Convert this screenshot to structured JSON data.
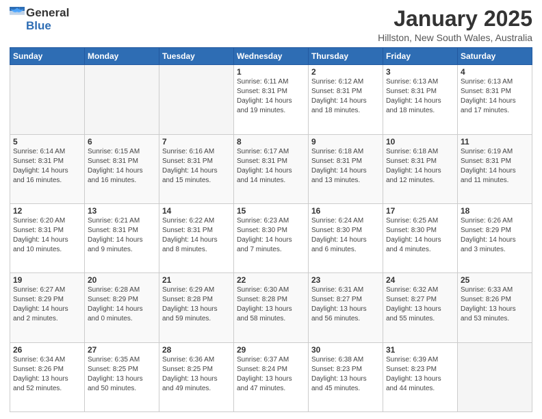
{
  "header": {
    "logo_general": "General",
    "logo_blue": "Blue",
    "month_title": "January 2025",
    "location": "Hillston, New South Wales, Australia"
  },
  "weekdays": [
    "Sunday",
    "Monday",
    "Tuesday",
    "Wednesday",
    "Thursday",
    "Friday",
    "Saturday"
  ],
  "weeks": [
    [
      {
        "day": "",
        "info": ""
      },
      {
        "day": "",
        "info": ""
      },
      {
        "day": "",
        "info": ""
      },
      {
        "day": "1",
        "info": "Sunrise: 6:11 AM\nSunset: 8:31 PM\nDaylight: 14 hours\nand 19 minutes."
      },
      {
        "day": "2",
        "info": "Sunrise: 6:12 AM\nSunset: 8:31 PM\nDaylight: 14 hours\nand 18 minutes."
      },
      {
        "day": "3",
        "info": "Sunrise: 6:13 AM\nSunset: 8:31 PM\nDaylight: 14 hours\nand 18 minutes."
      },
      {
        "day": "4",
        "info": "Sunrise: 6:13 AM\nSunset: 8:31 PM\nDaylight: 14 hours\nand 17 minutes."
      }
    ],
    [
      {
        "day": "5",
        "info": "Sunrise: 6:14 AM\nSunset: 8:31 PM\nDaylight: 14 hours\nand 16 minutes."
      },
      {
        "day": "6",
        "info": "Sunrise: 6:15 AM\nSunset: 8:31 PM\nDaylight: 14 hours\nand 16 minutes."
      },
      {
        "day": "7",
        "info": "Sunrise: 6:16 AM\nSunset: 8:31 PM\nDaylight: 14 hours\nand 15 minutes."
      },
      {
        "day": "8",
        "info": "Sunrise: 6:17 AM\nSunset: 8:31 PM\nDaylight: 14 hours\nand 14 minutes."
      },
      {
        "day": "9",
        "info": "Sunrise: 6:18 AM\nSunset: 8:31 PM\nDaylight: 14 hours\nand 13 minutes."
      },
      {
        "day": "10",
        "info": "Sunrise: 6:18 AM\nSunset: 8:31 PM\nDaylight: 14 hours\nand 12 minutes."
      },
      {
        "day": "11",
        "info": "Sunrise: 6:19 AM\nSunset: 8:31 PM\nDaylight: 14 hours\nand 11 minutes."
      }
    ],
    [
      {
        "day": "12",
        "info": "Sunrise: 6:20 AM\nSunset: 8:31 PM\nDaylight: 14 hours\nand 10 minutes."
      },
      {
        "day": "13",
        "info": "Sunrise: 6:21 AM\nSunset: 8:31 PM\nDaylight: 14 hours\nand 9 minutes."
      },
      {
        "day": "14",
        "info": "Sunrise: 6:22 AM\nSunset: 8:31 PM\nDaylight: 14 hours\nand 8 minutes."
      },
      {
        "day": "15",
        "info": "Sunrise: 6:23 AM\nSunset: 8:30 PM\nDaylight: 14 hours\nand 7 minutes."
      },
      {
        "day": "16",
        "info": "Sunrise: 6:24 AM\nSunset: 8:30 PM\nDaylight: 14 hours\nand 6 minutes."
      },
      {
        "day": "17",
        "info": "Sunrise: 6:25 AM\nSunset: 8:30 PM\nDaylight: 14 hours\nand 4 minutes."
      },
      {
        "day": "18",
        "info": "Sunrise: 6:26 AM\nSunset: 8:29 PM\nDaylight: 14 hours\nand 3 minutes."
      }
    ],
    [
      {
        "day": "19",
        "info": "Sunrise: 6:27 AM\nSunset: 8:29 PM\nDaylight: 14 hours\nand 2 minutes."
      },
      {
        "day": "20",
        "info": "Sunrise: 6:28 AM\nSunset: 8:29 PM\nDaylight: 14 hours\nand 0 minutes."
      },
      {
        "day": "21",
        "info": "Sunrise: 6:29 AM\nSunset: 8:28 PM\nDaylight: 13 hours\nand 59 minutes."
      },
      {
        "day": "22",
        "info": "Sunrise: 6:30 AM\nSunset: 8:28 PM\nDaylight: 13 hours\nand 58 minutes."
      },
      {
        "day": "23",
        "info": "Sunrise: 6:31 AM\nSunset: 8:27 PM\nDaylight: 13 hours\nand 56 minutes."
      },
      {
        "day": "24",
        "info": "Sunrise: 6:32 AM\nSunset: 8:27 PM\nDaylight: 13 hours\nand 55 minutes."
      },
      {
        "day": "25",
        "info": "Sunrise: 6:33 AM\nSunset: 8:26 PM\nDaylight: 13 hours\nand 53 minutes."
      }
    ],
    [
      {
        "day": "26",
        "info": "Sunrise: 6:34 AM\nSunset: 8:26 PM\nDaylight: 13 hours\nand 52 minutes."
      },
      {
        "day": "27",
        "info": "Sunrise: 6:35 AM\nSunset: 8:25 PM\nDaylight: 13 hours\nand 50 minutes."
      },
      {
        "day": "28",
        "info": "Sunrise: 6:36 AM\nSunset: 8:25 PM\nDaylight: 13 hours\nand 49 minutes."
      },
      {
        "day": "29",
        "info": "Sunrise: 6:37 AM\nSunset: 8:24 PM\nDaylight: 13 hours\nand 47 minutes."
      },
      {
        "day": "30",
        "info": "Sunrise: 6:38 AM\nSunset: 8:23 PM\nDaylight: 13 hours\nand 45 minutes."
      },
      {
        "day": "31",
        "info": "Sunrise: 6:39 AM\nSunset: 8:23 PM\nDaylight: 13 hours\nand 44 minutes."
      },
      {
        "day": "",
        "info": ""
      }
    ]
  ]
}
